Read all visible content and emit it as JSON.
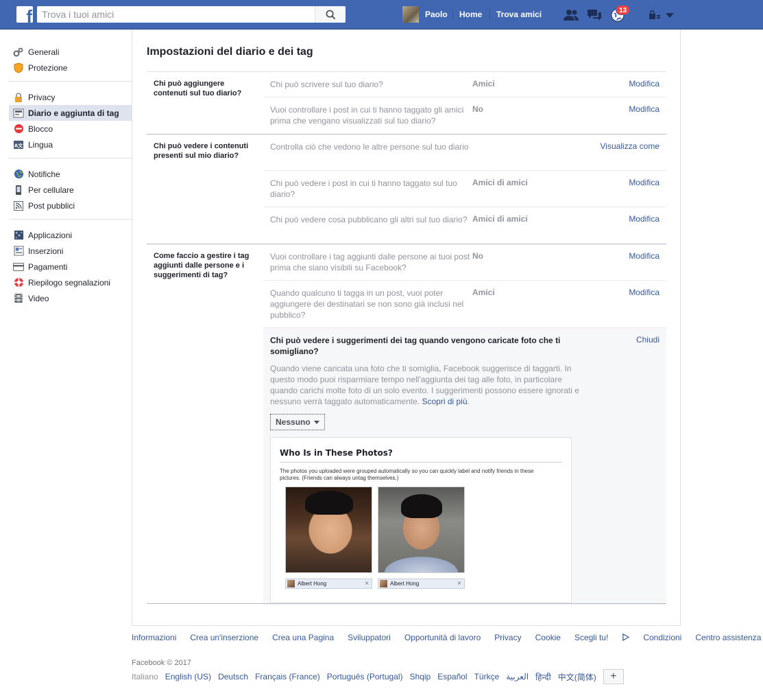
{
  "topbar": {
    "logo_letter": "f",
    "search_placeholder": "Trova i tuoi amici",
    "user_name": "Paolo",
    "home": "Home",
    "find_friends": "Trova amici",
    "notifications_count": "13",
    "icons": [
      "search-icon",
      "friend-requests-icon",
      "messages-icon",
      "notifications-icon",
      "privacy-shortcuts-icon",
      "account-menu-icon"
    ]
  },
  "sidebar": {
    "groups": [
      [
        {
          "label": "Generali",
          "icon": "gears-icon"
        },
        {
          "label": "Protezione",
          "icon": "shield-icon"
        }
      ],
      [
        {
          "label": "Privacy",
          "icon": "lock-icon"
        },
        {
          "label": "Diario e aggiunta di tag",
          "icon": "timeline-icon",
          "active": true
        },
        {
          "label": "Blocco",
          "icon": "block-icon"
        },
        {
          "label": "Lingua",
          "icon": "language-icon"
        }
      ],
      [
        {
          "label": "Notifiche",
          "icon": "globe-icon"
        },
        {
          "label": "Per cellulare",
          "icon": "mobile-icon"
        },
        {
          "label": "Post pubblici",
          "icon": "rss-icon"
        }
      ],
      [
        {
          "label": "Applicazioni",
          "icon": "apps-icon"
        },
        {
          "label": "Inserzioni",
          "icon": "ads-icon"
        },
        {
          "label": "Pagamenti",
          "icon": "card-icon"
        },
        {
          "label": "Riepilogo segnalazioni",
          "icon": "support-icon"
        },
        {
          "label": "Video",
          "icon": "film-icon"
        }
      ]
    ]
  },
  "main": {
    "title": "Impostazioni del diario e dei tag",
    "sections": [
      {
        "label": "Chi può aggiungere contenuti sul tuo diario?",
        "rows": [
          {
            "question": "Chi può scrivere sul tuo diario?",
            "value": "Amici",
            "action": "Modifica"
          },
          {
            "question": "Vuoi controllare i post in cui ti hanno taggato gli amici prima che vengano visualizzati sul tuo diario?",
            "value": "No",
            "action": "Modifica"
          }
        ]
      },
      {
        "label": "Chi può vedere i contenuti presenti sul mio diario?",
        "rows": [
          {
            "question": "Controlla ciò che vedono le altre persone sul tuo diario",
            "value": "",
            "action": "Visualizza come"
          },
          {
            "question": "Chi può vedere i post in cui ti hanno taggato sul tuo diario?",
            "value": "Amici di amici",
            "action": "Modifica"
          },
          {
            "question": "Chi può vedere cosa pubblicano gli altri sul tuo diario?",
            "value": "Amici di amici",
            "action": "Modifica"
          }
        ]
      },
      {
        "label": "Come faccio a gestire i tag aggiunti dalle persone e i suggerimenti di tag?",
        "rows": [
          {
            "question": "Vuoi controllare i tag aggiunti dalle persone ai tuoi post prima che siano visibili su Facebook?",
            "value": "No",
            "action": "Modifica"
          },
          {
            "question": "Quando qualcuno ti tagga in un post, vuoi poter aggiungere dei destinatari se non sono già inclusi nel pubblico?",
            "value": "Amici",
            "action": "Modifica"
          }
        ],
        "expanded": {
          "title": "Chi può vedere i suggerimenti dei tag quando vengono caricate foto che ti somigliano?",
          "close": "Chiudi",
          "description": "Quando viene caricata una foto che ti somiglia, Facebook suggerisce di taggarti. In questo modo puoi risparmiare tempo nell'aggiunta dei tag alle foto, in particolare quando carichi molte foto di un solo evento. I suggerimenti possono essere ignorati e nessuno verrà taggato automaticamente.",
          "learn_more": "Scopri di più",
          "dropdown_value": "Nessuno",
          "preview": {
            "title": "Who Is in These Photos?",
            "text": "The photos you uploaded were grouped automatically so you can quickly label and notify friends in these pictures. (Friends can always untag themselves.)",
            "tags": [
              "Albert Hong",
              "Albert Hong"
            ],
            "tag_remove": "×"
          }
        }
      }
    ]
  },
  "footer": {
    "links": [
      "Informazioni",
      "Crea un'inserzione",
      "Crea una Pagina",
      "Sviluppatori",
      "Opportunità di lavoro",
      "Privacy",
      "Cookie",
      "Scegli tu!",
      "Condizioni",
      "Centro assistenza"
    ],
    "copyright": "Facebook © 2017",
    "languages": [
      "Italiano",
      "English (US)",
      "Deutsch",
      "Français (France)",
      "Português (Portugal)",
      "Shqip",
      "Español",
      "Türkçe",
      "العربية",
      "हिन्दी",
      "中文(简体)"
    ],
    "more_languages": "+"
  }
}
